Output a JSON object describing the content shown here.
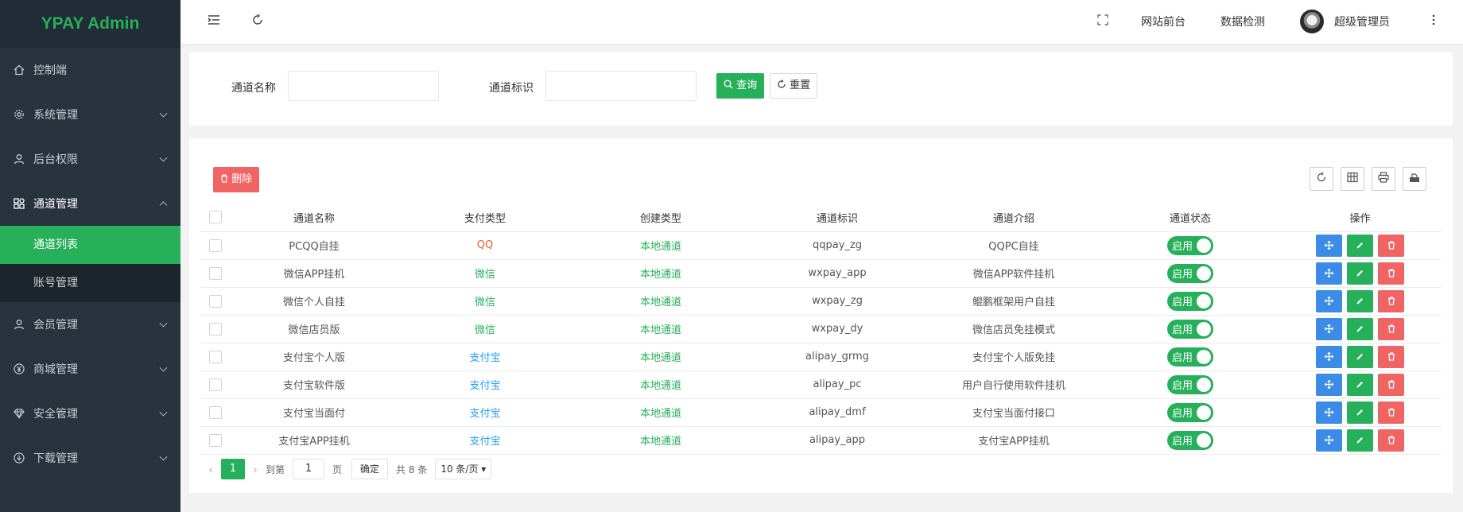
{
  "app": {
    "title": "YPAY Admin"
  },
  "sidebar": {
    "items": [
      {
        "label": "控制端",
        "icon": "home-icon"
      },
      {
        "label": "系统管理",
        "icon": "gear-icon"
      },
      {
        "label": "后台权限",
        "icon": "user-icon"
      },
      {
        "label": "通道管理",
        "icon": "apps-icon"
      },
      {
        "label": "会员管理",
        "icon": "user-icon"
      },
      {
        "label": "商城管理",
        "icon": "yen-icon"
      },
      {
        "label": "安全管理",
        "icon": "diamond-icon"
      },
      {
        "label": "下载管理",
        "icon": "download-icon"
      }
    ],
    "submenu": [
      {
        "label": "通道列表",
        "active": true
      },
      {
        "label": "账号管理",
        "active": false
      }
    ]
  },
  "header": {
    "links": [
      "网站前台",
      "数据检测"
    ],
    "user": "超级管理员"
  },
  "search": {
    "name_label": "通道名称",
    "name_value": "",
    "ident_label": "通道标识",
    "ident_value": "",
    "query_label": "查询",
    "reset_label": "重置"
  },
  "toolbar": {
    "delete_label": "删除"
  },
  "table": {
    "headers": [
      "通道名称",
      "支付类型",
      "创建类型",
      "通道标识",
      "通道介绍",
      "通道状态",
      "操作"
    ],
    "rows": [
      {
        "name": "PCQQ自挂",
        "pay_type": "QQ",
        "create_type": "本地通道",
        "ident": "qqpay_zg",
        "intro": "QQPC自挂",
        "status": "启用"
      },
      {
        "name": "微信APP挂机",
        "pay_type": "微信",
        "create_type": "本地通道",
        "ident": "wxpay_app",
        "intro": "微信APP软件挂机",
        "status": "启用"
      },
      {
        "name": "微信个人自挂",
        "pay_type": "微信",
        "create_type": "本地通道",
        "ident": "wxpay_zg",
        "intro": "鲲鹏框架用户自挂",
        "status": "启用"
      },
      {
        "name": "微信店员版",
        "pay_type": "微信",
        "create_type": "本地通道",
        "ident": "wxpay_dy",
        "intro": "微信店员免挂模式",
        "status": "启用"
      },
      {
        "name": "支付宝个人版",
        "pay_type": "支付宝",
        "create_type": "本地通道",
        "ident": "alipay_grmg",
        "intro": "支付宝个人版免挂",
        "status": "启用"
      },
      {
        "name": "支付宝软件版",
        "pay_type": "支付宝",
        "create_type": "本地通道",
        "ident": "alipay_pc",
        "intro": "用户自行使用软件挂机",
        "status": "启用"
      },
      {
        "name": "支付宝当面付",
        "pay_type": "支付宝",
        "create_type": "本地通道",
        "ident": "alipay_dmf",
        "intro": "支付宝当面付接口",
        "status": "启用"
      },
      {
        "name": "支付宝APP挂机",
        "pay_type": "支付宝",
        "create_type": "本地通道",
        "ident": "alipay_app",
        "intro": "支付宝APP挂机",
        "status": "启用"
      }
    ]
  },
  "pager": {
    "current": "1",
    "goto_label": "到第",
    "goto_value": "1",
    "page_unit": "页",
    "confirm_label": "确定",
    "total": "共 8 条",
    "per_page": "10 条/页"
  },
  "colors": {
    "accent": "#27b05a",
    "qq": "#f05a28",
    "wechat": "#27b05a",
    "alipay": "#1e9fff",
    "danger": "#f06464",
    "info": "#3c8ce7"
  }
}
